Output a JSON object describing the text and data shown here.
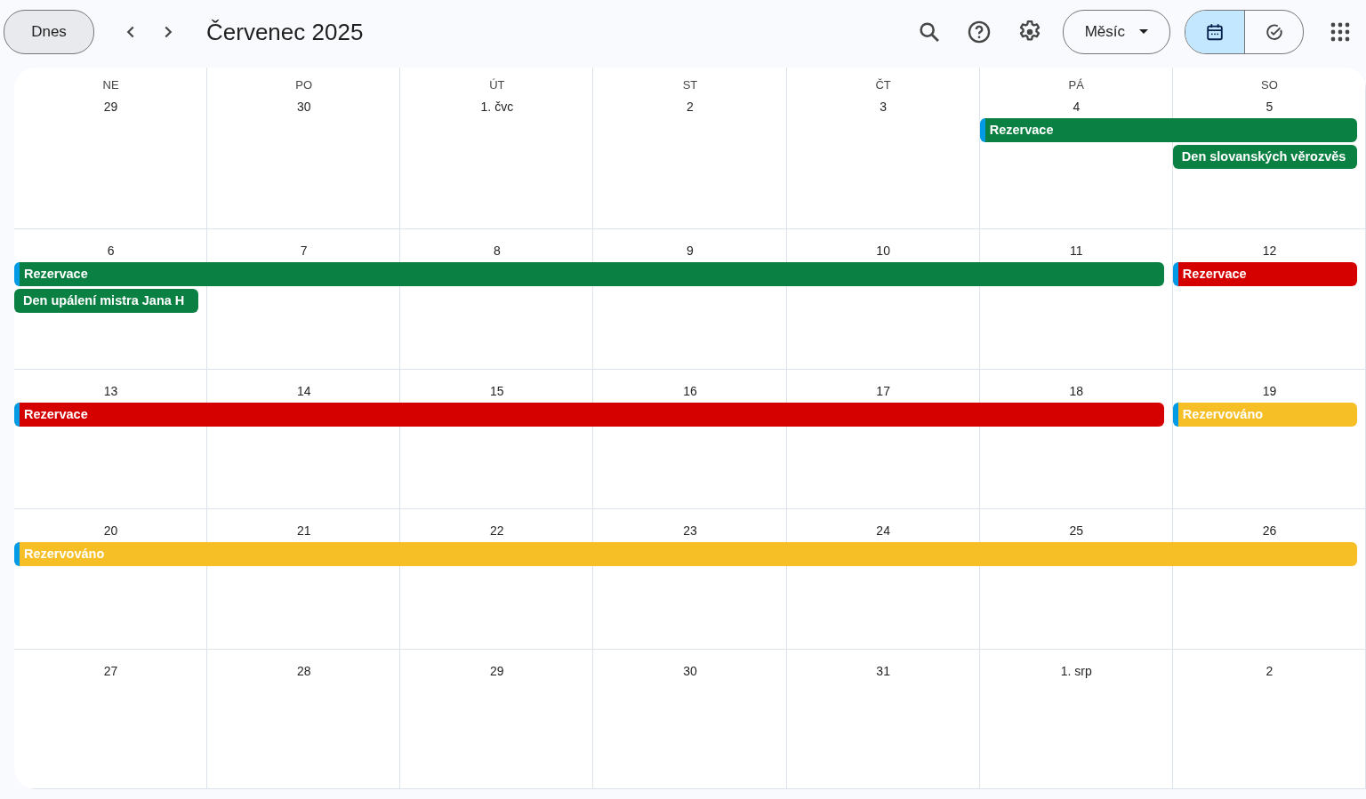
{
  "toolbar": {
    "today_button": "Dnes",
    "title": "Červenec 2025",
    "view_dropdown": "Měsíc",
    "view_toggle": [
      {
        "kind": "calendar",
        "selected": true
      },
      {
        "kind": "tasks",
        "selected": false
      }
    ]
  },
  "weekdays": [
    "NE",
    "PO",
    "ÚT",
    "ST",
    "ČT",
    "PÁ",
    "SO"
  ],
  "weeks": [
    {
      "days": [
        "29",
        "30",
        "1. čvc",
        "2",
        "3",
        "4",
        "5"
      ],
      "lanes": [
        [
          {
            "kind": "empty"
          },
          {
            "kind": "empty"
          },
          {
            "kind": "empty"
          },
          {
            "kind": "empty"
          },
          {
            "kind": "empty"
          },
          {
            "kind": "event",
            "title": "Rezervace",
            "color": "#0b8043",
            "marked": true
          },
          {
            "kind": "continued"
          }
        ],
        [
          {
            "kind": "empty"
          },
          {
            "kind": "empty"
          },
          {
            "kind": "empty"
          },
          {
            "kind": "empty"
          },
          {
            "kind": "empty"
          },
          {
            "kind": "empty"
          },
          {
            "kind": "event",
            "title": "Den slovanských věrozvěs",
            "color": "#0b8043",
            "marked": false
          }
        ]
      ]
    },
    {
      "days": [
        "6",
        "7",
        "8",
        "9",
        "10",
        "11",
        "12"
      ],
      "lanes": [
        [
          {
            "kind": "event",
            "title": "Rezervace",
            "color": "#0b8043",
            "marked": true
          },
          {
            "kind": "continued"
          },
          {
            "kind": "continued"
          },
          {
            "kind": "continued"
          },
          {
            "kind": "continued"
          },
          {
            "kind": "continued"
          },
          {
            "kind": "event",
            "title": "Rezervace",
            "color": "#d50000",
            "marked": true
          }
        ],
        [
          {
            "kind": "event",
            "title": "Den upálení mistra Jana H",
            "color": "#0b8043",
            "marked": false
          },
          {
            "kind": "empty"
          },
          {
            "kind": "empty"
          },
          {
            "kind": "empty"
          },
          {
            "kind": "empty"
          },
          {
            "kind": "empty"
          },
          {
            "kind": "empty"
          }
        ]
      ]
    },
    {
      "days": [
        "13",
        "14",
        "15",
        "16",
        "17",
        "18",
        "19"
      ],
      "lanes": [
        [
          {
            "kind": "event",
            "title": "Rezervace",
            "color": "#d50000",
            "marked": true
          },
          {
            "kind": "continued"
          },
          {
            "kind": "continued"
          },
          {
            "kind": "continued"
          },
          {
            "kind": "continued"
          },
          {
            "kind": "continued"
          },
          {
            "kind": "event",
            "title": "Rezervováno",
            "color": "#f6bf26",
            "marked": true
          }
        ]
      ]
    },
    {
      "days": [
        "20",
        "21",
        "22",
        "23",
        "24",
        "25",
        "26"
      ],
      "lanes": [
        [
          {
            "kind": "event",
            "title": "Rezervováno",
            "color": "#f6bf26",
            "marked": true
          },
          {
            "kind": "continued"
          },
          {
            "kind": "continued"
          },
          {
            "kind": "continued"
          },
          {
            "kind": "continued"
          },
          {
            "kind": "continued"
          },
          {
            "kind": "continued"
          }
        ]
      ]
    },
    {
      "days": [
        "27",
        "28",
        "29",
        "30",
        "31",
        "1. srp",
        "2"
      ]
    }
  ]
}
